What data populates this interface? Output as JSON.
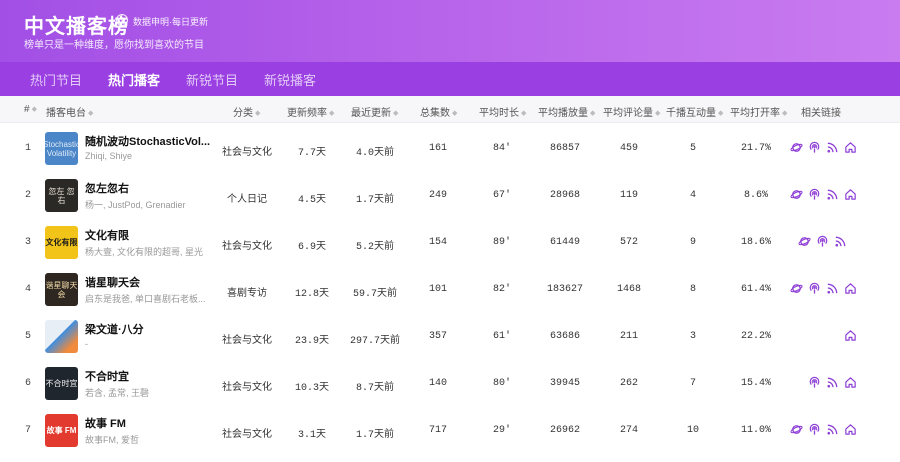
{
  "header": {
    "title": "中文播客榜",
    "notice": "数据申明·每日更新",
    "subtitle": "榜单只是一种维度，愿你找到喜欢的节目"
  },
  "tabs": [
    "热门节目",
    "热门播客",
    "新锐节目",
    "新锐播客"
  ],
  "active_tab": "热门播客",
  "columns": {
    "rank": "#",
    "podcast": "播客电台",
    "category": "分类",
    "frequency": "更新频率",
    "latest": "最近更新",
    "episodes": "总集数",
    "avg_duration": "平均时长",
    "avg_plays": "平均播放量",
    "avg_comments": "平均评论量",
    "interactions": "千播互动量",
    "open_rate": "平均打开率",
    "links": "相关链接"
  },
  "rows": [
    {
      "rank": "1",
      "name": "随机波动StochasticVol...",
      "authors": "Zhiqi, Shiye",
      "category": "社会与文化",
      "frequency": "7.7天",
      "latest": "4.0天前",
      "episodes": "161",
      "duration": "84'",
      "plays": "86857",
      "comments": "459",
      "interactions": "5",
      "open_rate": "21.7%",
      "cover_text": "Stochastic Volatility"
    },
    {
      "rank": "2",
      "name": "忽左忽右",
      "authors": "杨一, JustPod, Grenadier",
      "category": "个人日记",
      "frequency": "4.5天",
      "latest": "1.7天前",
      "episodes": "249",
      "duration": "67'",
      "plays": "28968",
      "comments": "119",
      "interactions": "4",
      "open_rate": "8.6%",
      "cover_text": "忽左 忽右"
    },
    {
      "rank": "3",
      "name": "文化有限",
      "authors": "杨大壹, 文化有限的超哥, 星光",
      "category": "社会与文化",
      "frequency": "6.9天",
      "latest": "5.2天前",
      "episodes": "154",
      "duration": "89'",
      "plays": "61449",
      "comments": "572",
      "interactions": "9",
      "open_rate": "18.6%",
      "cover_text": "文化有限"
    },
    {
      "rank": "4",
      "name": "谐星聊天会",
      "authors": "启东是我爸, 单口喜剧石老板...",
      "category": "喜剧专访",
      "frequency": "12.8天",
      "latest": "59.7天前",
      "episodes": "101",
      "duration": "82'",
      "plays": "183627",
      "comments": "1468",
      "interactions": "8",
      "open_rate": "61.4%",
      "cover_text": "谐星聊天会"
    },
    {
      "rank": "5",
      "name": "梁文道·八分",
      "authors": "-",
      "category": "社会与文化",
      "frequency": "23.9天",
      "latest": "297.7天前",
      "episodes": "357",
      "duration": "61'",
      "plays": "63686",
      "comments": "211",
      "interactions": "3",
      "open_rate": "22.2%",
      "cover_text": ""
    },
    {
      "rank": "6",
      "name": "不合时宜",
      "authors": "若含, 孟常, 王磬",
      "category": "社会与文化",
      "frequency": "10.3天",
      "latest": "8.7天前",
      "episodes": "140",
      "duration": "80'",
      "plays": "39945",
      "comments": "262",
      "interactions": "7",
      "open_rate": "15.4%",
      "cover_text": "不合时宜"
    },
    {
      "rank": "7",
      "name": "故事 FM",
      "authors": "故事FM, 爱哲",
      "category": "社会与文化",
      "frequency": "3.1天",
      "latest": "1.7天前",
      "episodes": "717",
      "duration": "29'",
      "plays": "26962",
      "comments": "274",
      "interactions": "10",
      "open_rate": "11.0%",
      "cover_text": "故事 FM"
    }
  ],
  "link_icons": [
    "planet-icon",
    "podcast-icon",
    "rss-icon",
    "home-icon"
  ],
  "colors": {
    "header_gradient_start": "#a24fe6",
    "header_gradient_end": "#c97cf0",
    "tab_bar": "#9a3fe2",
    "link_icon": "#8e3fd6",
    "table_header_bg": "#f7f7f9"
  }
}
